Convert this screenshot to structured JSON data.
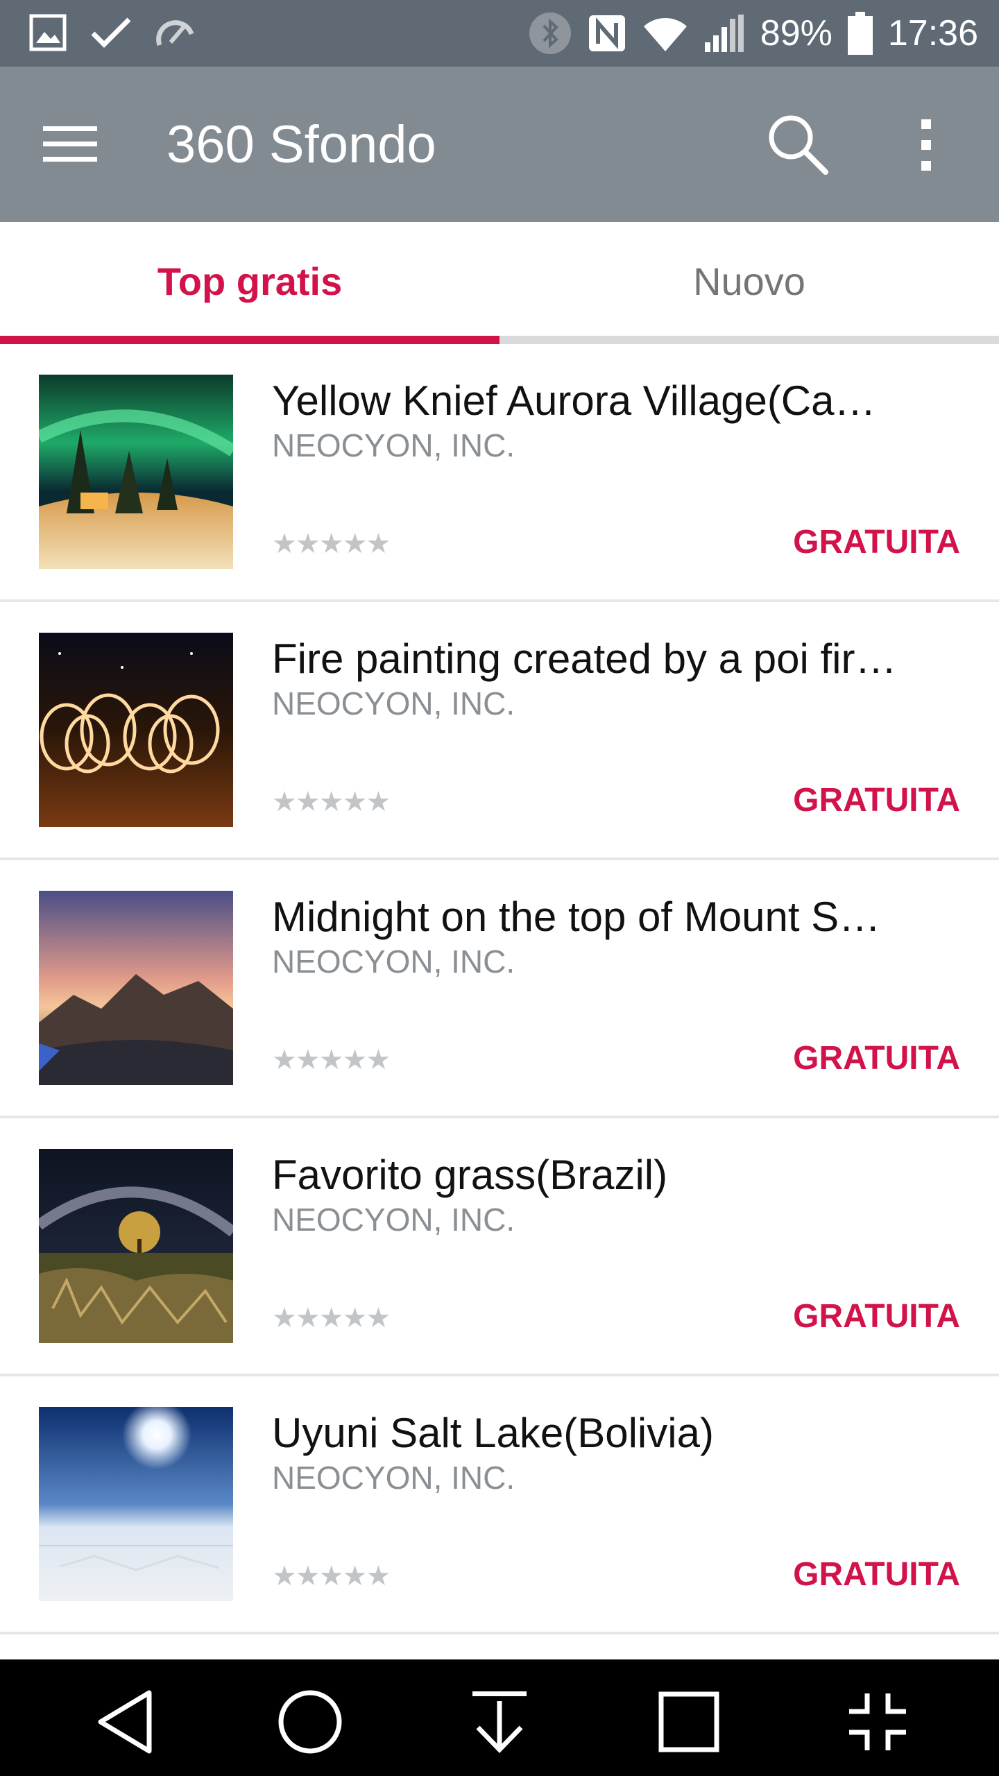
{
  "status_bar": {
    "icons_left": [
      "image-icon",
      "check-icon",
      "speedometer-icon"
    ],
    "icons_right": [
      "bluetooth-icon",
      "nfc-icon",
      "wifi-icon",
      "signal-icon",
      "battery-icon"
    ],
    "battery": "89%",
    "time": "17:36"
  },
  "app_bar": {
    "title": "360 Sfondo",
    "menu_icon": "hamburger-menu-icon",
    "search_icon": "search-icon",
    "more_icon": "more-vert-icon"
  },
  "tabs": [
    {
      "label": "Top gratis",
      "active": true
    },
    {
      "label": "Nuovo",
      "active": false
    }
  ],
  "colors": {
    "accent": "#d2134a",
    "app_bar": "#838b92",
    "status_bar": "#5f6a75"
  },
  "items": [
    {
      "title": "Yellow Knief Aurora Village(Ca…",
      "developer": "NEOCYON, INC.",
      "stars": "★★★★★",
      "rating": 0,
      "price": "GRATUITA"
    },
    {
      "title": "Fire painting created by a poi fir…",
      "developer": "NEOCYON, INC.",
      "stars": "★★★★★",
      "rating": 0,
      "price": "GRATUITA"
    },
    {
      "title": "Midnight on the top of Mount S…",
      "developer": "NEOCYON, INC.",
      "stars": "★★★★★",
      "rating": 0,
      "price": "GRATUITA"
    },
    {
      "title": "Favorito grass(Brazil)",
      "developer": "NEOCYON, INC.",
      "stars": "★★★★★",
      "rating": 0,
      "price": "GRATUITA"
    },
    {
      "title": "Uyuni Salt Lake(Bolivia)",
      "developer": "NEOCYON, INC.",
      "stars": "★★★★★",
      "rating": 0,
      "price": "GRATUITA"
    }
  ],
  "nav_bar": {
    "buttons": [
      "back-icon",
      "home-icon",
      "download-icon",
      "recents-icon",
      "fullscreen-exit-icon"
    ]
  }
}
